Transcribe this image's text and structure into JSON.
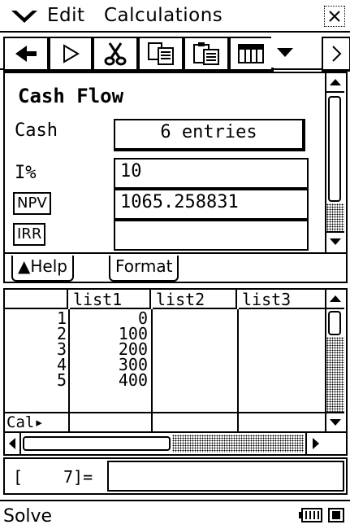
{
  "menubar": {
    "menu_icon": "chevron-down-double-icon",
    "edit_label": "Edit",
    "calculations_label": "Calculations",
    "close_icon": "close-icon"
  },
  "toolbar": {
    "buttons": [
      "back-arrow-icon",
      "play-icon",
      "cut-icon",
      "copy-icon",
      "paste-icon",
      "spreadsheet-icon",
      "dropdown-icon",
      "more-right-icon"
    ]
  },
  "finance": {
    "title": "Cash Flow",
    "cash_label": "Cash",
    "cash_button": "6 entries",
    "i_label": "I%",
    "i_value": "10",
    "npv_label": "NPV",
    "npv_value": "1065.258831",
    "irr_label": "IRR",
    "irr_value": ""
  },
  "tabs": {
    "help": "▲Help",
    "format": "Format"
  },
  "sheet": {
    "columns": [
      "list1",
      "list2",
      "list3"
    ],
    "rows": [
      {
        "n": "1",
        "list1": "0",
        "list2": "",
        "list3": ""
      },
      {
        "n": "2",
        "list1": "100",
        "list2": "",
        "list3": ""
      },
      {
        "n": "3",
        "list1": "200",
        "list2": "",
        "list3": ""
      },
      {
        "n": "4",
        "list1": "300",
        "list2": "",
        "list3": ""
      },
      {
        "n": "5",
        "list1": "400",
        "list2": "",
        "list3": ""
      }
    ],
    "cal_label": "Cal▸"
  },
  "entry": {
    "prefix": "[",
    "index": "7]=",
    "value": ""
  },
  "statusbar": {
    "mode": "Solve",
    "battery_icon": "battery-icon",
    "toggle_icon": "square-toggle-icon"
  }
}
